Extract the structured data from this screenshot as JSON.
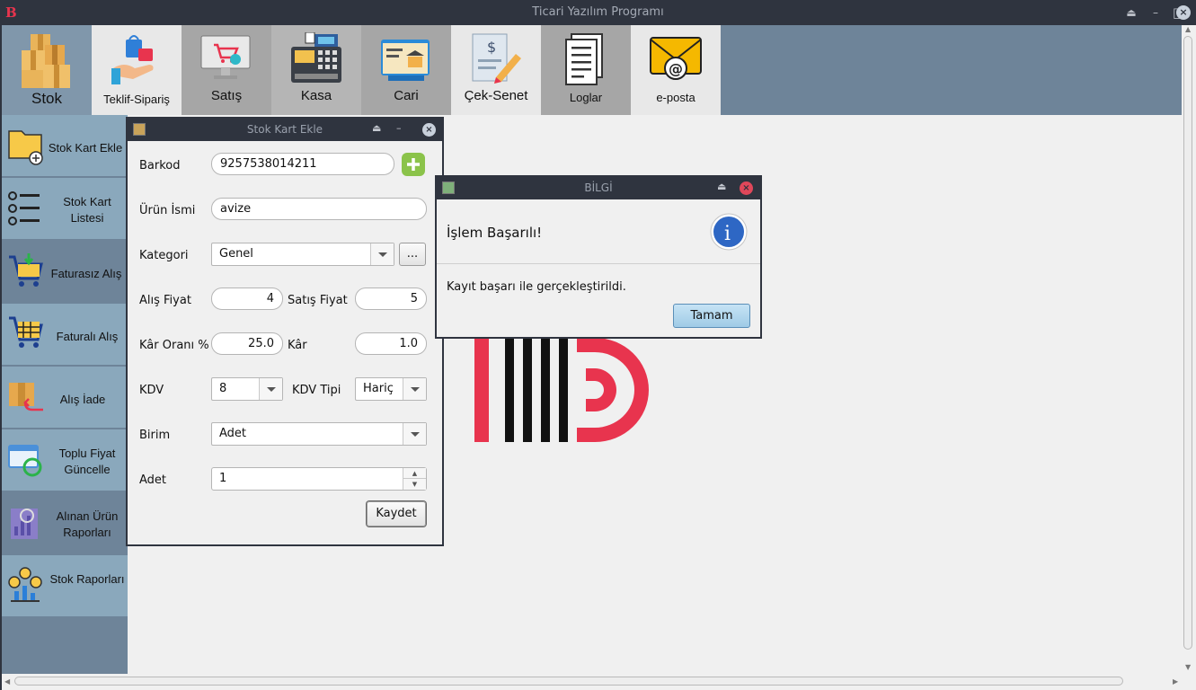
{
  "window": {
    "title": "Ticari Yazılım Programı",
    "app_icon": "B"
  },
  "top_tabs": [
    {
      "label": "Stok",
      "icon": "boxes-icon"
    },
    {
      "label": "Teklif-Sipariş",
      "icon": "hand-bag-icon"
    },
    {
      "label": "Satış",
      "icon": "monitor-cart-icon"
    },
    {
      "label": "Kasa",
      "icon": "cash-register-icon"
    },
    {
      "label": "Cari",
      "icon": "bank-card-icon"
    },
    {
      "label": "Çek-Senet",
      "icon": "check-pen-icon"
    },
    {
      "label": "Loglar",
      "icon": "document-icon"
    },
    {
      "label": "e-posta",
      "icon": "envelope-at-icon"
    }
  ],
  "sidebar": [
    {
      "label": "Stok Kart Ekle",
      "icon": "folder-add-icon"
    },
    {
      "label": "Stok Kart Listesi",
      "icon": "list-icon"
    },
    {
      "label": "Faturasız Alış",
      "icon": "cart-download-icon"
    },
    {
      "label": "Faturalı Alış",
      "icon": "cart-invoice-icon"
    },
    {
      "label": "Alış İade",
      "icon": "box-return-icon"
    },
    {
      "label": "Toplu Fiyat Güncelle",
      "icon": "browser-refresh-icon"
    },
    {
      "label": "Alınan Ürün Raporları",
      "icon": "chart-report-icon"
    },
    {
      "label": "Stok Raporları",
      "icon": "coins-chart-icon"
    }
  ],
  "stok_kart": {
    "title": "Stok Kart Ekle",
    "barkod_label": "Barkod",
    "barkod_value": "9257538014211",
    "urun_label": "Ürün İsmi",
    "urun_value": "avize",
    "kategori_label": "Kategori",
    "kategori_value": "Genel",
    "browse_label": "...",
    "alis_label": "Alış Fiyat",
    "alis_value": "4",
    "satis_label": "Satış Fiyat",
    "satis_value": "5",
    "kar_orani_label": "Kâr Oranı %",
    "kar_orani_value": "25.0",
    "kar_label": "Kâr",
    "kar_value": "1.0",
    "kdv_label": "KDV",
    "kdv_value": "8",
    "kdv_tipi_label": "KDV Tipi",
    "kdv_tipi_value": "Hariç",
    "birim_label": "Birim",
    "birim_value": "Adet",
    "adet_label": "Adet",
    "adet_value": "1",
    "save_label": "Kaydet"
  },
  "dialog": {
    "title": "BİLGİ",
    "heading": "İşlem Başarılı!",
    "message": "Kayıt başarı ile gerçekleştirildi.",
    "ok_label": "Tamam"
  },
  "colors": {
    "sidebar": "#6e8499",
    "selected": "#8aa8bc",
    "titlebar": "#2f343f",
    "brand_red": "#e8344e"
  }
}
